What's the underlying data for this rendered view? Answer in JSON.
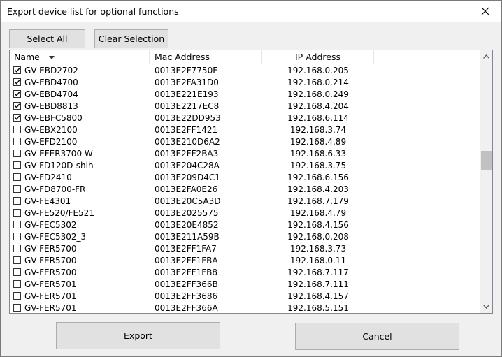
{
  "window": {
    "title": "Export device list for optional functions"
  },
  "toolbar": {
    "select_all": "Select All",
    "clear_selection": "Clear Selection"
  },
  "columns": {
    "name": "Name",
    "mac": "Mac Address",
    "ip": "IP Address"
  },
  "rows": [
    {
      "name": "GV-EBD2702",
      "mac": "0013E2F7750F",
      "ip": "192.168.0.205",
      "checked": true
    },
    {
      "name": "GV-EBD4700",
      "mac": "0013E2FA31D0",
      "ip": "192.168.0.214",
      "checked": true
    },
    {
      "name": "GV-EBD4704",
      "mac": "0013E221E193",
      "ip": "192.168.0.249",
      "checked": true
    },
    {
      "name": "GV-EBD8813",
      "mac": "0013E2217EC8",
      "ip": "192.168.4.204",
      "checked": true
    },
    {
      "name": "GV-EBFC5800",
      "mac": "0013E22DD953",
      "ip": "192.168.6.114",
      "checked": true
    },
    {
      "name": "GV-EBX2100",
      "mac": "0013E2FF1421",
      "ip": "192.168.3.74",
      "checked": false
    },
    {
      "name": "GV-EFD2100",
      "mac": "0013E210D6A2",
      "ip": "192.168.4.89",
      "checked": false
    },
    {
      "name": "GV-EFER3700-W",
      "mac": "0013E2FF2BA3",
      "ip": "192.168.6.33",
      "checked": false
    },
    {
      "name": "GV-FD120D-shih",
      "mac": "0013E204C28A",
      "ip": "192.168.3.75",
      "checked": false
    },
    {
      "name": "GV-FD2410",
      "mac": "0013E209D4C1",
      "ip": "192.168.6.156",
      "checked": false
    },
    {
      "name": "GV-FD8700-FR",
      "mac": "0013E2FA0E26",
      "ip": "192.168.4.203",
      "checked": false
    },
    {
      "name": "GV-FE4301",
      "mac": "0013E20C5A3D",
      "ip": "192.168.7.179",
      "checked": false
    },
    {
      "name": "GV-FE520/FE521",
      "mac": "0013E2025575",
      "ip": "192.168.4.79",
      "checked": false
    },
    {
      "name": "GV-FEC5302",
      "mac": "0013E20E4852",
      "ip": "192.168.4.156",
      "checked": false
    },
    {
      "name": "GV-FEC5302_3",
      "mac": "0013E211A59B",
      "ip": "192.168.0.208",
      "checked": false
    },
    {
      "name": "GV-FER5700",
      "mac": "0013E2FF1FA7",
      "ip": "192.168.3.73",
      "checked": false
    },
    {
      "name": "GV-FER5700",
      "mac": "0013E2FF1FBA",
      "ip": "192.168.0.11",
      "checked": false
    },
    {
      "name": "GV-FER5700",
      "mac": "0013E2FF1FB8",
      "ip": "192.168.7.117",
      "checked": false
    },
    {
      "name": "GV-FER5701",
      "mac": "0013E2FF366B",
      "ip": "192.168.7.111",
      "checked": false
    },
    {
      "name": "GV-FER5701",
      "mac": "0013E2FF3686",
      "ip": "192.168.4.157",
      "checked": false
    },
    {
      "name": "GV-FER5701",
      "mac": "0013E2FF366A",
      "ip": "192.168.5.151",
      "checked": false
    }
  ],
  "footer": {
    "export": "Export",
    "cancel": "Cancel"
  }
}
